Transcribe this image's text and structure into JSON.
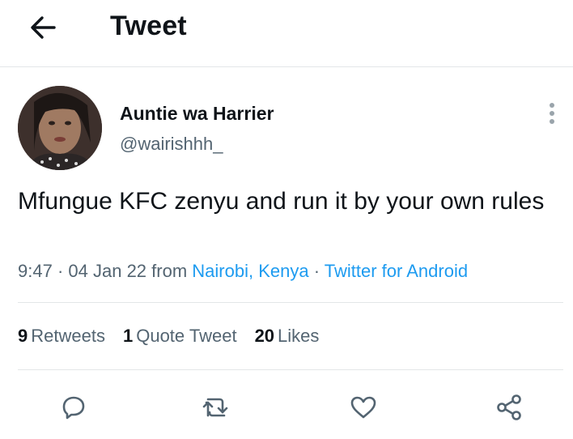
{
  "header": {
    "title": "Tweet",
    "back_icon": "arrow-left-icon"
  },
  "author": {
    "name": "Auntie wa Harrier",
    "handle": "@wairishhh_"
  },
  "tweet": {
    "text": "Mfungue KFC zenyu and run it by your own rules",
    "time": "9:47",
    "date": "04 Jan 22",
    "from_word": "from",
    "location": "Nairobi, Kenya",
    "source": "Twitter for Android",
    "separator": "·"
  },
  "stats": {
    "retweets_count": "9",
    "retweets_label": "Retweets",
    "quotes_count": "1",
    "quotes_label": "Quote Tweet",
    "likes_count": "20",
    "likes_label": "Likes"
  },
  "actions": [
    "reply-icon",
    "retweet-icon",
    "like-icon",
    "share-icon"
  ],
  "colors": {
    "link": "#1d9bf0",
    "muted": "#536471",
    "text": "#0f1419",
    "divider": "#e3e6e8"
  }
}
